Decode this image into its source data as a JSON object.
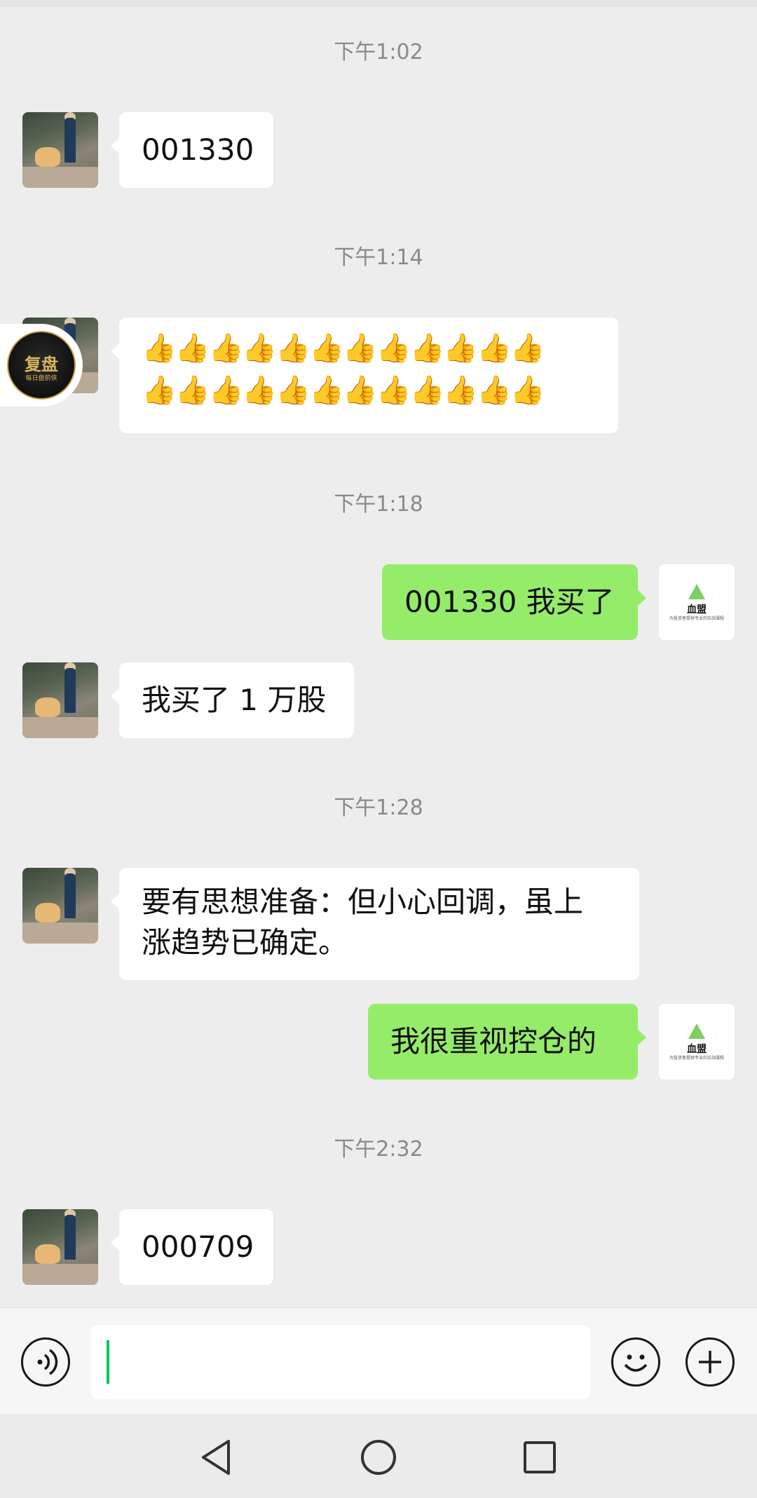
{
  "messages": [
    {
      "time": "下午1:02",
      "side": "left",
      "text": "001330"
    },
    {
      "time": "下午1:14",
      "side": "left",
      "emoji_line_1": "👍👍👍👍👍👍👍👍👍👍👍👍",
      "emoji_line_2": "👍👍👍👍👍👍👍👍👍👍👍👍"
    },
    {
      "time": "下午1:18",
      "side": "right",
      "text": "001330 我买了"
    },
    {
      "side": "left",
      "text": "我买了 1 万股"
    },
    {
      "time": "下午1:28",
      "side": "left",
      "line1": "要有思想准备：但小心回调，虽上",
      "line2": "涨趋势已确定。"
    },
    {
      "side": "right",
      "text": "我很重视控仓的"
    },
    {
      "time": "下午2:32",
      "side": "left",
      "text": "000709"
    }
  ],
  "avatars": {
    "self_logo_text": "血盟",
    "self_logo_subtext": "为投资者提供专业的实战课程"
  },
  "float_badge": {
    "title": "复盘",
    "subtitle": "每日盘前侠"
  },
  "input": {
    "value": "",
    "icons": {
      "voice": "voice-icon",
      "emoji": "emoji-icon",
      "more": "plus-icon"
    }
  },
  "navigation": {
    "back": "back-triangle-icon",
    "home": "home-circle-icon",
    "recents": "recents-square-icon"
  },
  "colors": {
    "background": "#ededed",
    "bubble_self": "#95ec69",
    "bubble_other": "#ffffff",
    "caret": "#07c160",
    "timestamp": "#8a8a8a"
  }
}
